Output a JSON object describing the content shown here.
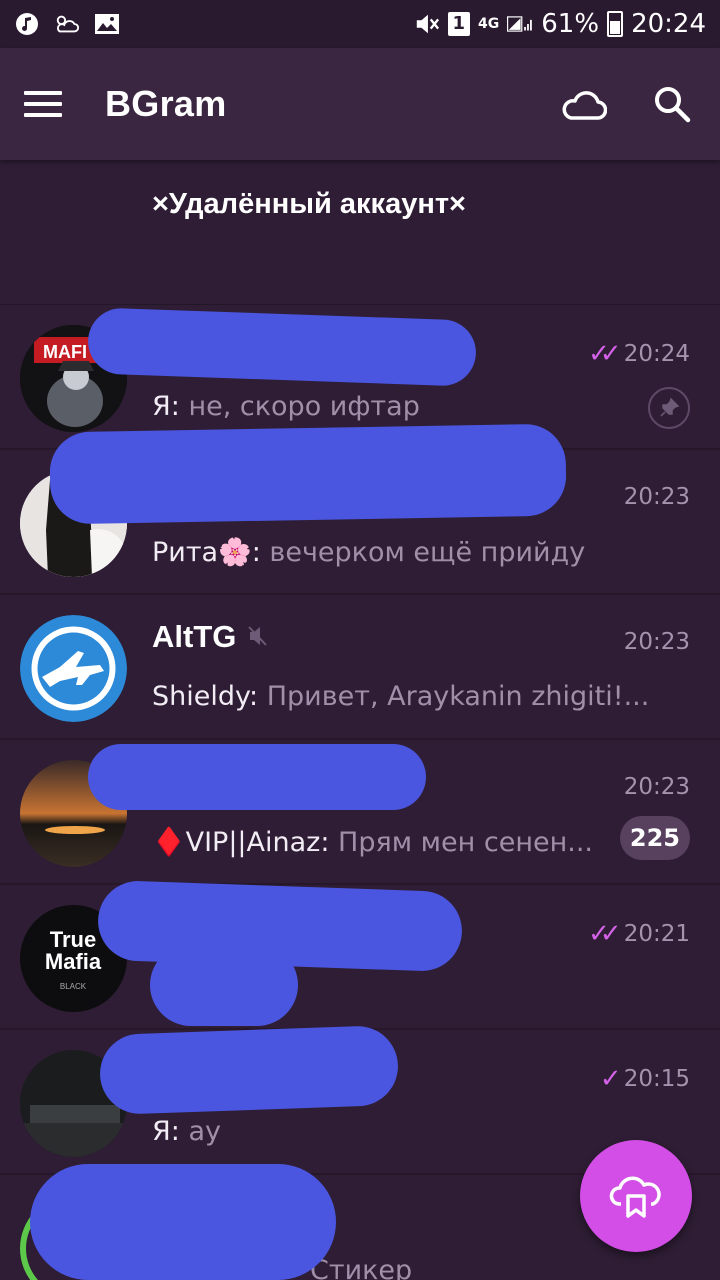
{
  "status_bar": {
    "sim_indicator": "1",
    "network": "4G",
    "battery_percent": "61%",
    "time": "20:24"
  },
  "app_bar": {
    "title": "BGram"
  },
  "deleted_account_title": "×Удалённый аккаунт×",
  "chats": [
    {
      "sender": "Я",
      "preview": "не, скоро ифтар",
      "time": "20:24",
      "status": "read",
      "pinned": true
    },
    {
      "sender": "Рита🌸",
      "preview": "вечерком ещё прийду",
      "time": "20:23"
    },
    {
      "name": "AltTG",
      "muted": true,
      "sender": "Shieldy",
      "preview": "Привет, Araykanin zhigiti!...",
      "time": "20:23"
    },
    {
      "sender": "♦️VIP||Ainaz",
      "preview": "Прям мен сенен...",
      "time": "20:23",
      "unread": "225"
    },
    {
      "time": "20:21",
      "status": "read"
    },
    {
      "sender": "Я",
      "preview": "ау",
      "time": "20:15",
      "status": "sent"
    },
    {
      "preview": "Стикер"
    }
  ],
  "avatar_texts": {
    "mafia": "MAFI",
    "true_mafia_line1": "True",
    "true_mafia_line2": "Mafia",
    "true_mafia_line3": "BLACK"
  },
  "colors": {
    "background": "#2e1d34",
    "app_bar": "#3a2640",
    "accent": "#d24ee6",
    "check": "#d462e8",
    "badge": "#58405f"
  },
  "icons": [
    "music-icon",
    "weather-icon",
    "image-icon",
    "mute-icon",
    "signal-icon",
    "battery-icon",
    "menu-icon",
    "cloud-icon",
    "search-icon",
    "pin-icon",
    "muted-icon",
    "cloud-bookmark-icon"
  ]
}
